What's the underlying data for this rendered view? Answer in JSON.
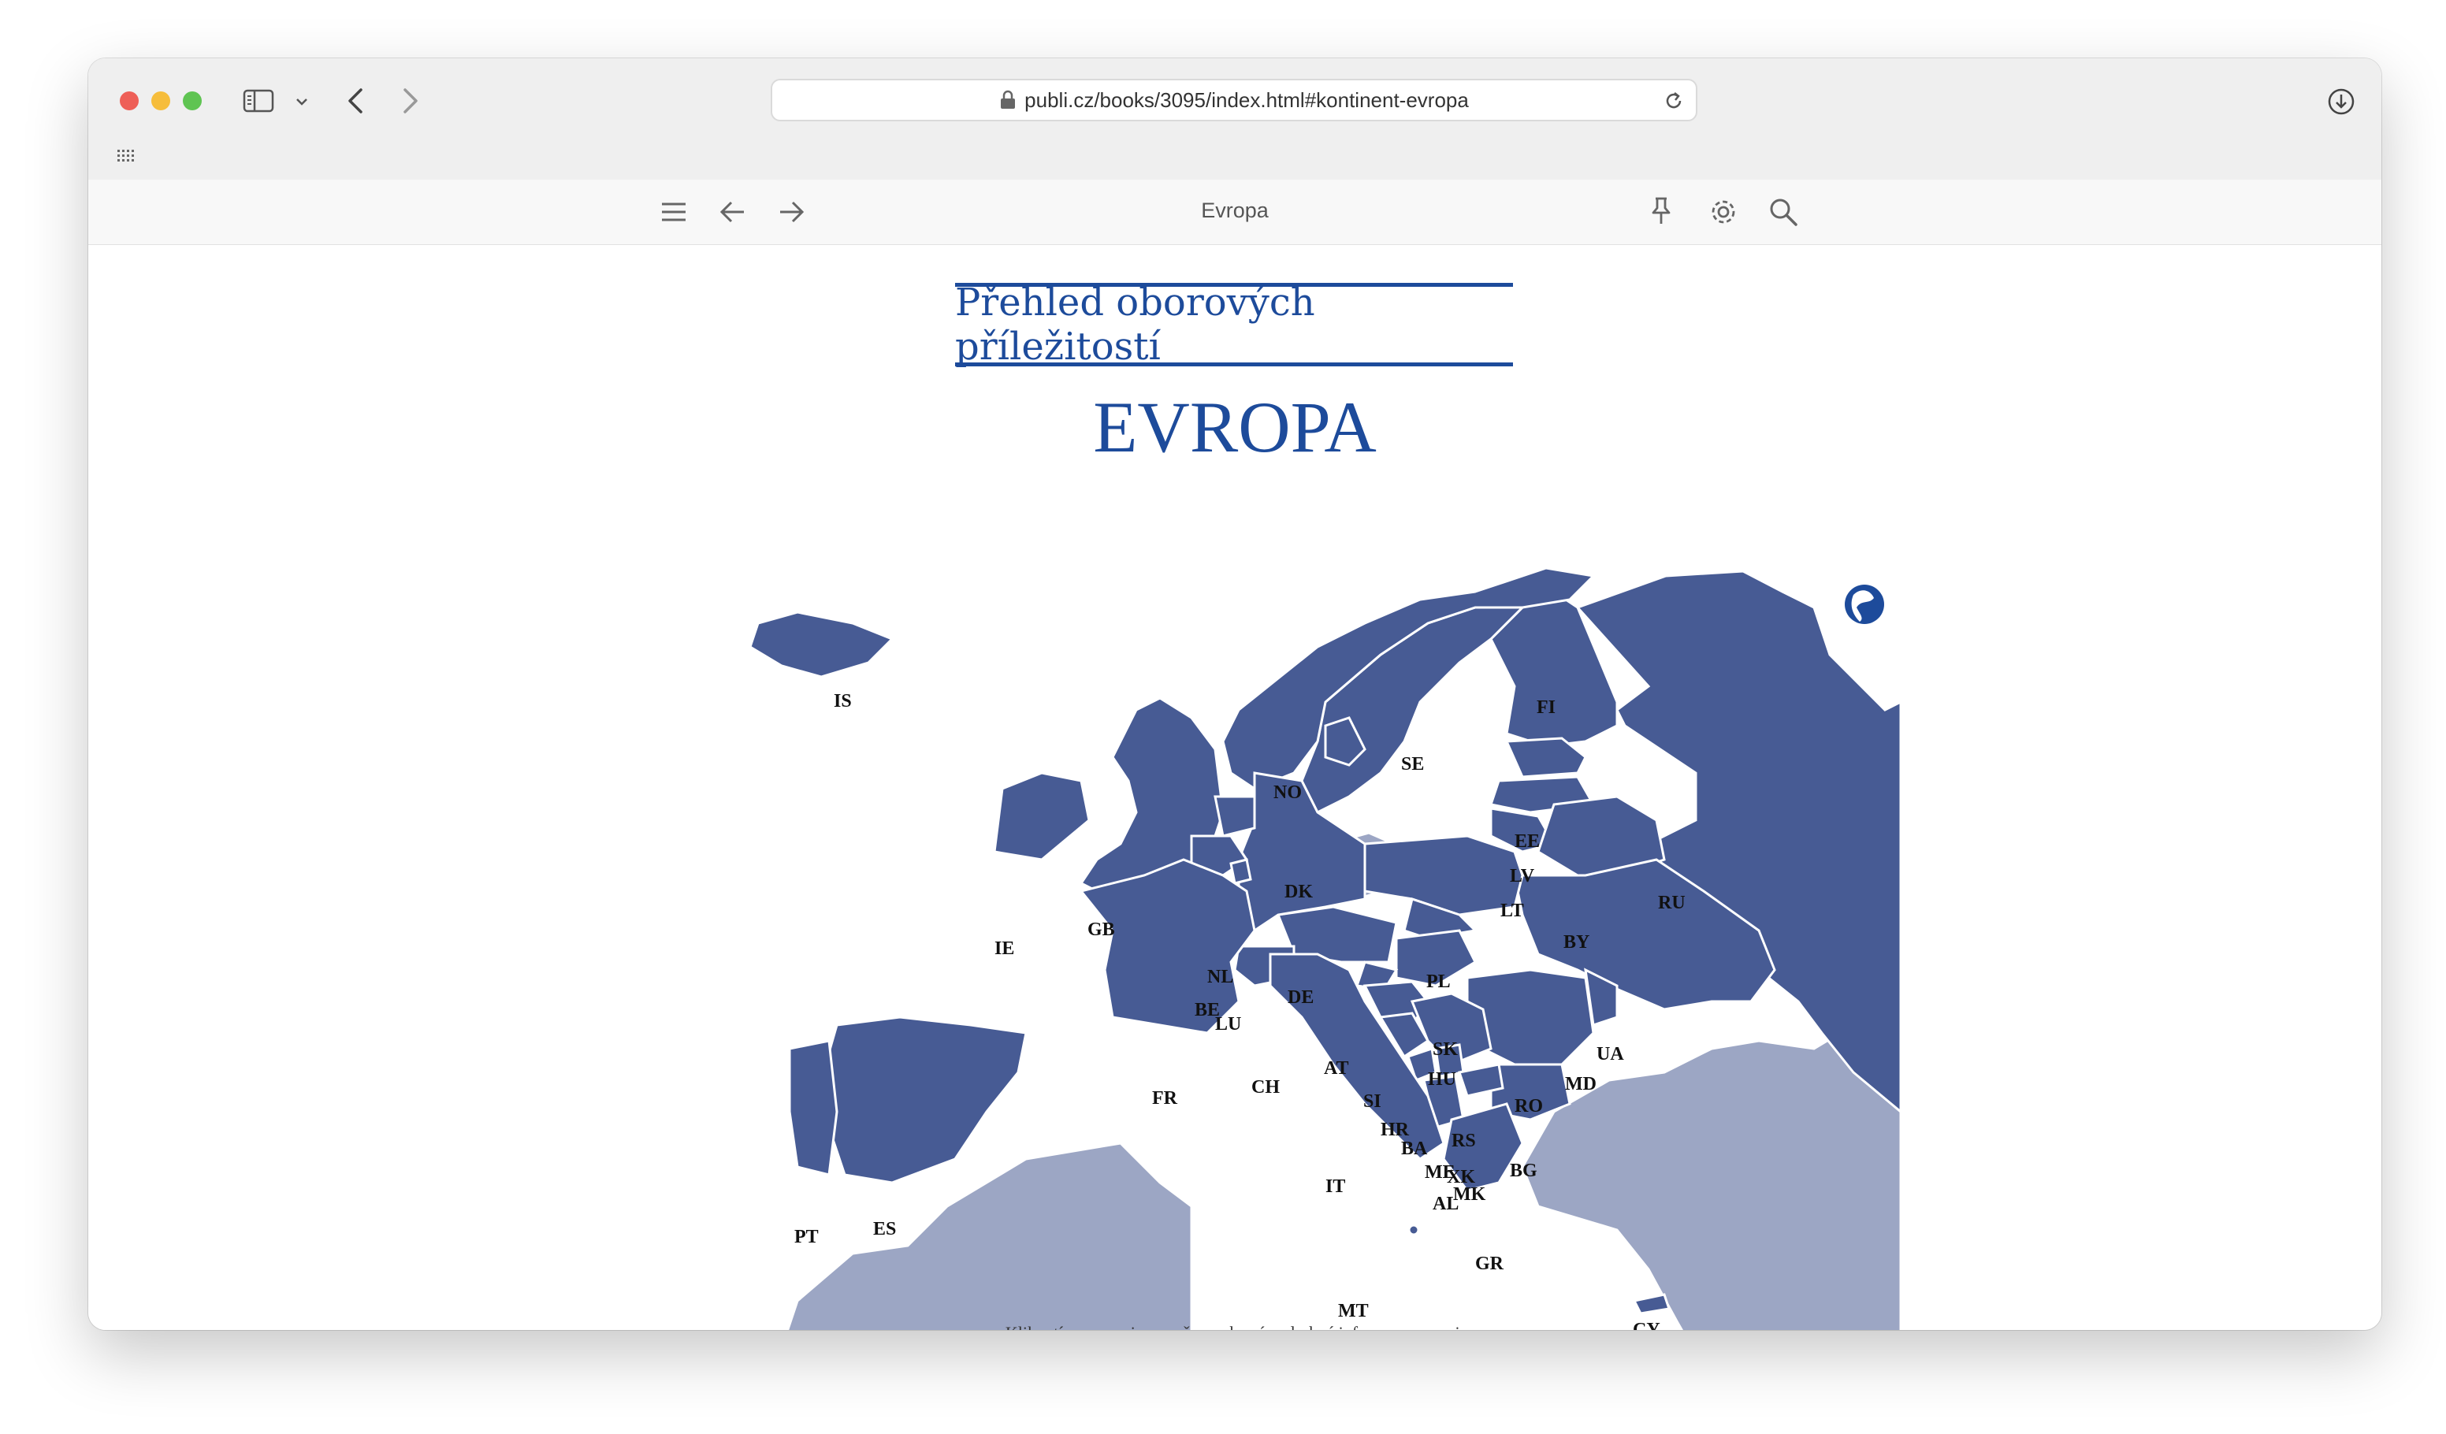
{
  "browser": {
    "url": "publi.cz/books/3095/index.html#kontinent-evropa"
  },
  "reader": {
    "title": "Evropa"
  },
  "page": {
    "subtitle": "Přehled oborových příležitostí",
    "title": "EVROPA",
    "caption": "Kliknutím na zemi v mapě se zobrazí podrobné informace o zemi."
  },
  "map": {
    "colors": {
      "active": "#475b94",
      "inactive": "#9ca6c4",
      "border": "#ffffff"
    },
    "countries": [
      "IS",
      "FI",
      "SE",
      "NO",
      "EE",
      "LV",
      "DK",
      "LT",
      "RU",
      "IE",
      "GB",
      "BY",
      "NL",
      "DE",
      "PL",
      "BE",
      "LU",
      "SK",
      "UA",
      "AT",
      "CH",
      "HU",
      "MD",
      "FR",
      "SI",
      "RO",
      "HR",
      "RS",
      "BA",
      "ME",
      "XK",
      "BG",
      "MK",
      "AL",
      "IT",
      "PT",
      "ES",
      "GR",
      "MT",
      "CY"
    ]
  }
}
